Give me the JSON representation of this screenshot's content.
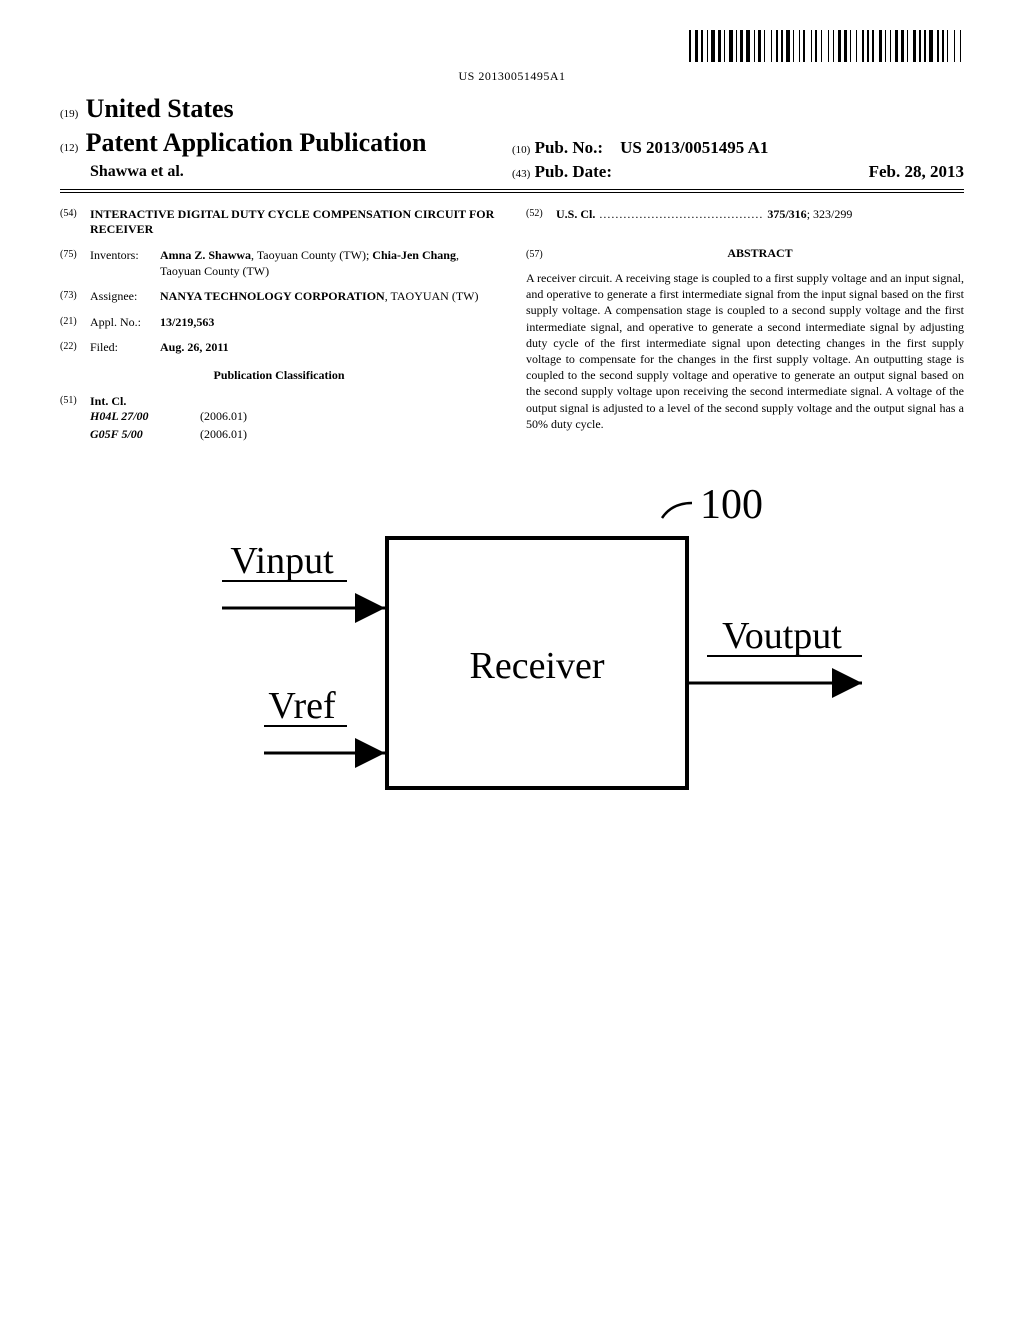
{
  "barcode_text": "US 20130051495A1",
  "header": {
    "num19": "(19)",
    "country": "United States",
    "num12": "(12)",
    "pub_type": "Patent Application Publication",
    "authors": "Shawwa et al.",
    "num10": "(10)",
    "pub_no_label": "Pub. No.:",
    "pub_no": "US 2013/0051495 A1",
    "num43": "(43)",
    "pub_date_label": "Pub. Date:",
    "pub_date": "Feb. 28, 2013"
  },
  "left": {
    "num54": "(54)",
    "title": "INTERACTIVE DIGITAL DUTY CYCLE COMPENSATION CIRCUIT FOR RECEIVER",
    "num75": "(75)",
    "inventors_label": "Inventors:",
    "inventor1_name": "Amna Z. Shawwa",
    "inventor1_loc": ", Taoyuan County (TW); ",
    "inventor2_name": "Chia-Jen Chang",
    "inventor2_loc": ", Taoyuan County (TW)",
    "num73": "(73)",
    "assignee_label": "Assignee:",
    "assignee_name": "NANYA TECHNOLOGY CORPORATION",
    "assignee_loc": ", TAOYUAN (TW)",
    "num21": "(21)",
    "applno_label": "Appl. No.:",
    "applno": "13/219,563",
    "num22": "(22)",
    "filed_label": "Filed:",
    "filed": "Aug. 26, 2011",
    "classification_heading": "Publication Classification",
    "num51": "(51)",
    "intcl_label": "Int. Cl.",
    "intcl1_code": "H04L 27/00",
    "intcl1_date": "(2006.01)",
    "intcl2_code": "G05F 5/00",
    "intcl2_date": "(2006.01)"
  },
  "right": {
    "num52": "(52)",
    "uscl_label": "U.S. Cl.",
    "uscl_dots": " ......................................... ",
    "uscl_main": "375/316",
    "uscl_secondary": "; 323/299",
    "num57": "(57)",
    "abstract_heading": "ABSTRACT",
    "abstract": "A receiver circuit. A receiving stage is coupled to a first supply voltage and an input signal, and operative to generate a first intermediate signal from the input signal based on the first supply voltage. A compensation stage is coupled to a second supply voltage and the first intermediate signal, and operative to generate a second intermediate signal by adjusting duty cycle of the first intermediate signal upon detecting changes in the first supply voltage to compensate for the changes in the first supply voltage. An outputting stage is coupled to the second supply voltage and operative to generate an output signal based on the second supply voltage upon receiving the second intermediate signal. A voltage of the output signal is adjusted to a level of the second supply voltage and the output signal has a 50% duty cycle."
  },
  "figure": {
    "ref_num": "100",
    "vinput": "Vinput",
    "vref": "Vref",
    "box_label": "Receiver",
    "voutput": "Voutput"
  }
}
